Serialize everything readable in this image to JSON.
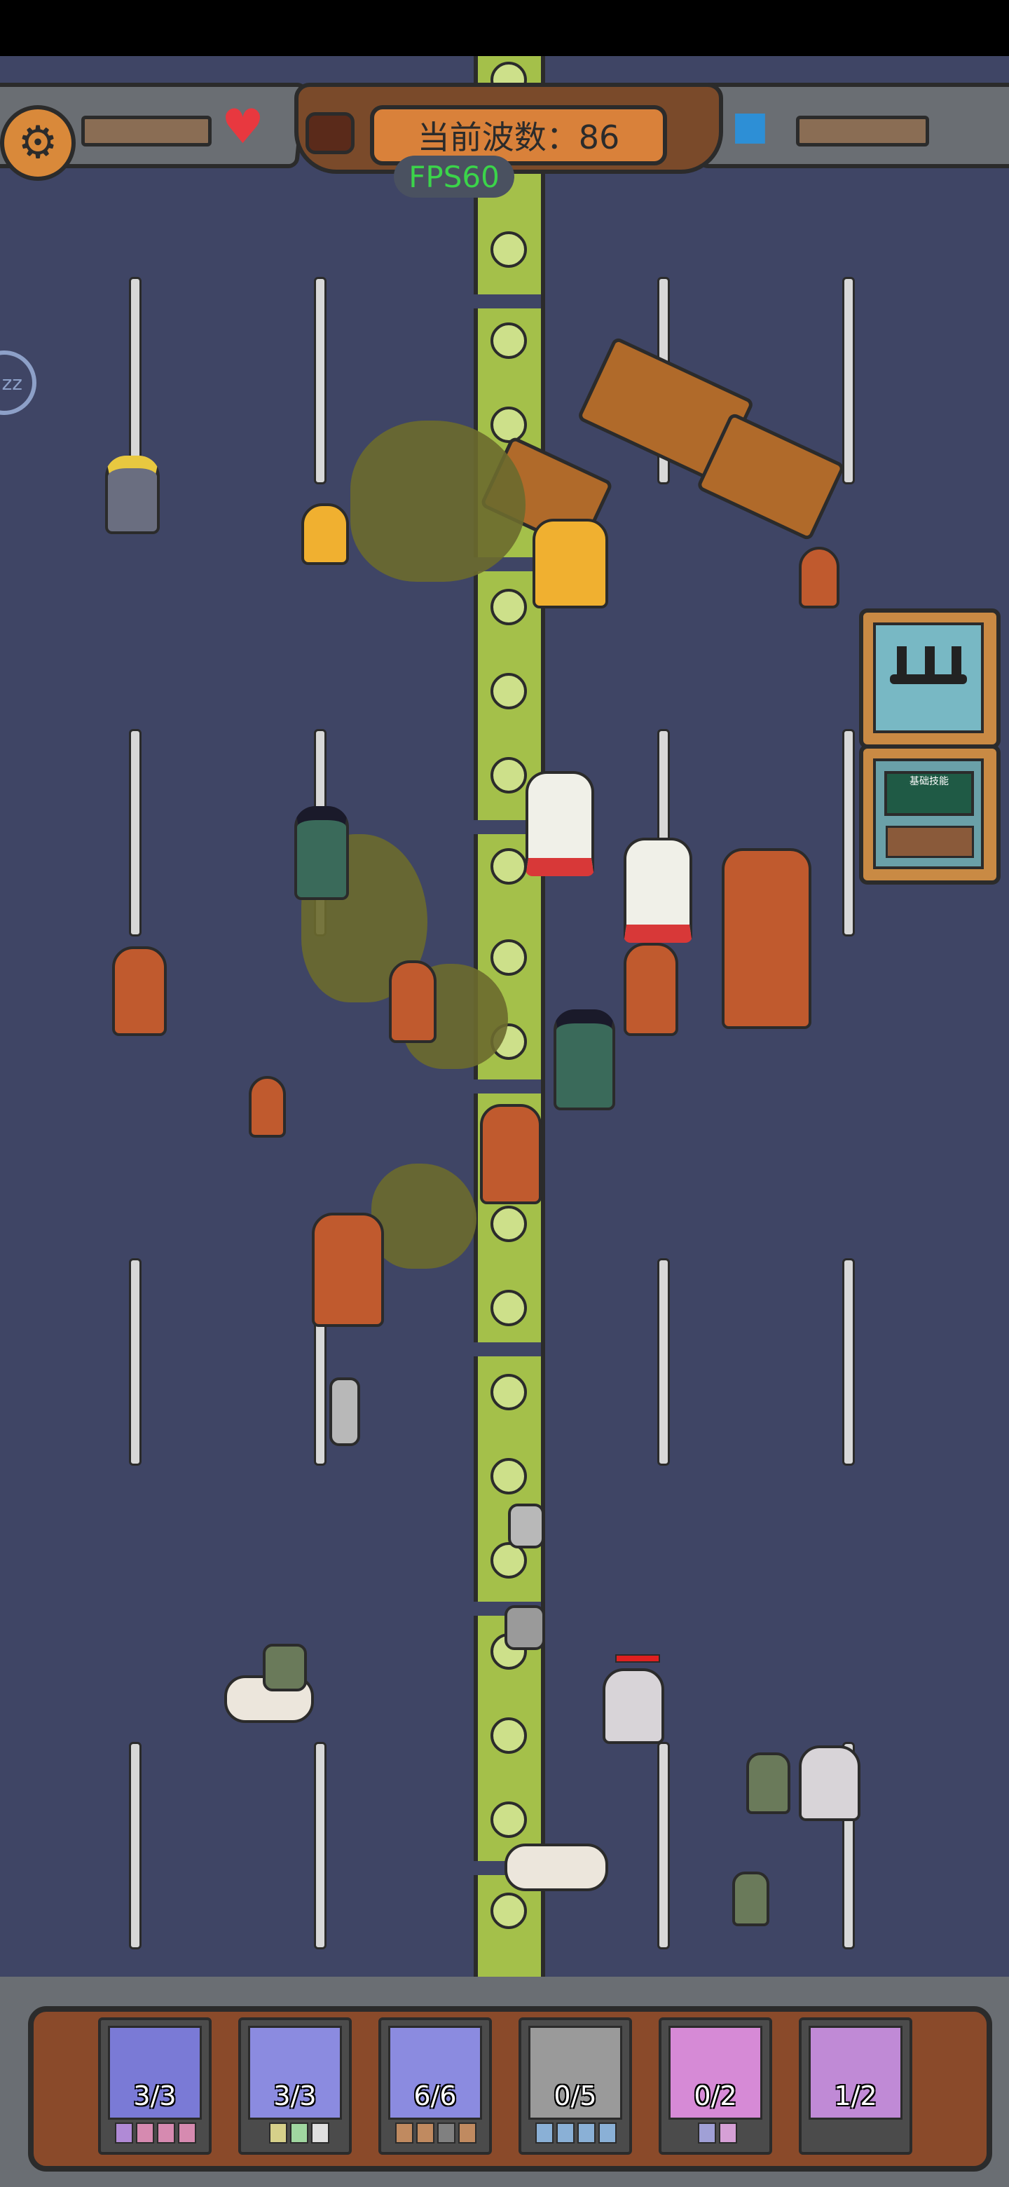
{
  "hud": {
    "wave_label": "当前波数：86",
    "fps": "FPS60",
    "side_tab_label": "zz",
    "settings_icon": "gear-icon",
    "health_icon": "heart-icon",
    "resource_icon": "cube-icon"
  },
  "side_buttons": [
    {
      "name": "weapon-rack-card",
      "icon": "weapon-rack-icon"
    },
    {
      "name": "classroom-card",
      "label": "基础技能",
      "icon": "blackboard-icon"
    }
  ],
  "unit_cards": [
    {
      "count": "3/3",
      "unit": "mage",
      "portrait_color": "#7a7ad6",
      "skill_colors": [
        "#b08ad6",
        "#d68ab0",
        "#d68ab0",
        "#d68ab0"
      ]
    },
    {
      "count": "3/3",
      "unit": "drummer",
      "portrait_color": "#8b8be0",
      "skill_colors": [
        "#d6d08a",
        "#a0d6a0",
        "#e0e0e0"
      ]
    },
    {
      "count": "6/6",
      "unit": "spearman",
      "portrait_color": "#8b8be0",
      "skill_colors": [
        "#c08a60",
        "#c08a60",
        "#808080",
        "#c08a60"
      ]
    },
    {
      "count": "0/5",
      "unit": "catapult",
      "portrait_color": "#9a9a9a",
      "skill_colors": [
        "#8ab0d6",
        "#8ab0d6",
        "#8ab0d6",
        "#8ab0d6"
      ]
    },
    {
      "count": "0/2",
      "unit": "monk",
      "portrait_color": "#d68ad6",
      "skill_colors": [
        "#a0a0d6",
        "#d6a0d6"
      ]
    },
    {
      "count": "1/2",
      "unit": "knight",
      "portrait_color": "#c08ad6",
      "skill_colors": []
    }
  ],
  "colors": {
    "background": "#3f4565",
    "road_median": "#a4c04a",
    "wave_box": "#d9813a",
    "fps_text": "#3bd44a",
    "heart": "#e8383f",
    "cube": "#2d8fd6"
  }
}
